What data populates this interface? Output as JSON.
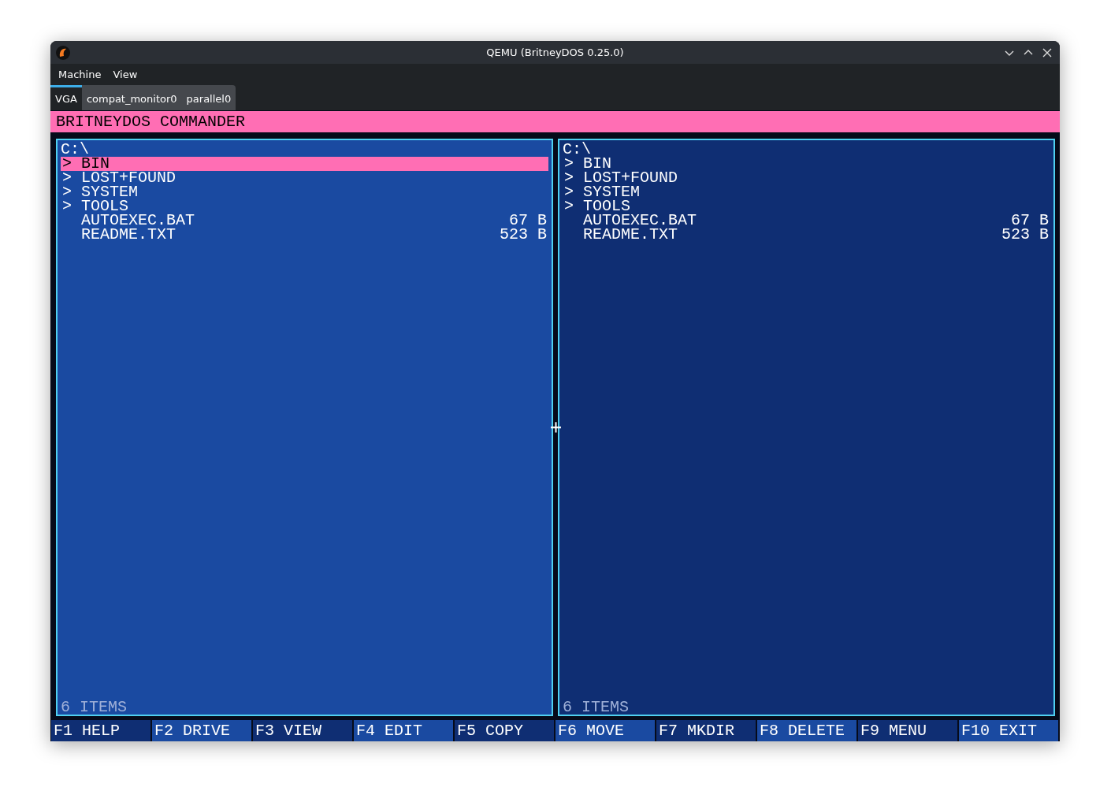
{
  "window": {
    "title": "QEMU (BritneyDOS 0.25.0)"
  },
  "menu": [
    "Machine",
    "View"
  ],
  "tabs": [
    {
      "label": "VGA",
      "selected": true
    },
    {
      "label": "compat_monitor0",
      "selected": false
    },
    {
      "label": "parallel0",
      "selected": false
    }
  ],
  "screen": {
    "header": "BRITNEYDOS COMMANDER",
    "panels": [
      {
        "active": true,
        "path": "C:\\",
        "footer": "6 ITEMS",
        "items": [
          {
            "kind": "dir",
            "marker": ">",
            "name": "BIN",
            "selected": true
          },
          {
            "kind": "dir",
            "marker": ">",
            "name": "LOST+FOUND",
            "selected": false
          },
          {
            "kind": "dir",
            "marker": ">",
            "name": "SYSTEM",
            "selected": false
          },
          {
            "kind": "dir",
            "marker": ">",
            "name": "TOOLS",
            "selected": false
          },
          {
            "kind": "file",
            "name": "AUTOEXEC.BAT",
            "size": "67 B",
            "selected": false
          },
          {
            "kind": "file",
            "name": "README.TXT",
            "size": "523 B",
            "selected": false
          }
        ]
      },
      {
        "active": false,
        "path": "C:\\",
        "footer": "6 ITEMS",
        "items": [
          {
            "kind": "dir",
            "marker": ">",
            "name": "BIN",
            "selected": false
          },
          {
            "kind": "dir",
            "marker": ">",
            "name": "LOST+FOUND",
            "selected": false
          },
          {
            "kind": "dir",
            "marker": ">",
            "name": "SYSTEM",
            "selected": false
          },
          {
            "kind": "dir",
            "marker": ">",
            "name": "TOOLS",
            "selected": false
          },
          {
            "kind": "file",
            "name": "AUTOEXEC.BAT",
            "size": "67 B",
            "selected": false
          },
          {
            "kind": "file",
            "name": "README.TXT",
            "size": "523 B",
            "selected": false
          }
        ]
      }
    ],
    "function_keys": [
      "F1 HELP",
      "F2 DRIVE",
      "F3 VIEW",
      "F4 EDIT",
      "F5 COPY",
      "F6 MOVE",
      "F7 MKDIR",
      "F8 DELETE",
      "F9 MENU",
      "F10 EXIT"
    ]
  }
}
